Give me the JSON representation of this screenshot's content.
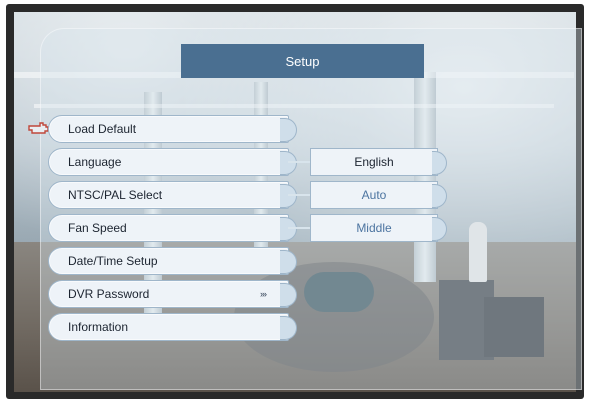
{
  "title": "Setup",
  "menu": {
    "items": [
      {
        "label": "Load Default"
      },
      {
        "label": "Language"
      },
      {
        "label": "NTSC/PAL Select"
      },
      {
        "label": "Fan Speed"
      },
      {
        "label": "Date/Time Setup"
      },
      {
        "label": "DVR Password",
        "submenu_indicator": "›››"
      },
      {
        "label": "Information"
      }
    ]
  },
  "values": {
    "language": "English",
    "ntsc_pal": "Auto",
    "fan_speed": "Middle"
  },
  "icons": {
    "pointer": "hand-pointer-icon"
  },
  "colors": {
    "title_bg": "#4a6f91",
    "item_bg": "#eef3f8",
    "dim_value": "#4c74a0"
  }
}
